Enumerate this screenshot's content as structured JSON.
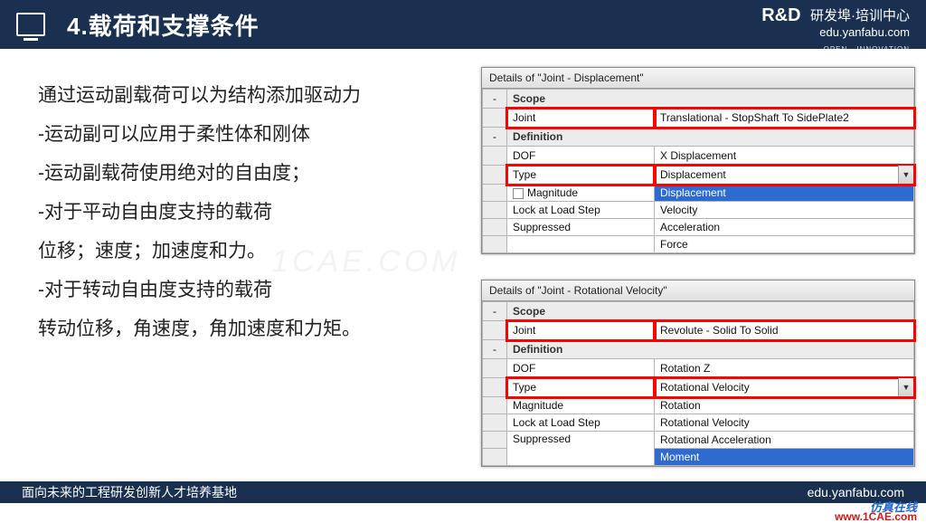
{
  "header": {
    "title": "4.载荷和支撑条件",
    "brand_logo": "R&D",
    "brand_tiny": "OPEN · INNOVATION",
    "brand_cn": "研发埠·培训中心",
    "brand_url": "edu.yanfabu.com"
  },
  "body_text": {
    "p1": "通过运动副载荷可以为结构添加驱动力",
    "p2": "-运动副可以应用于柔性体和刚体",
    "p3": "-运动副载荷使用绝对的自由度；",
    "p4": "-对于平动自由度支持的载荷",
    "p5": "位移；速度；加速度和力。",
    "p6": "-对于转动自由度支持的载荷",
    "p7": "转动位移，角速度，角加速度和力矩。"
  },
  "panel1": {
    "title": "Details of \"Joint - Displacement\"",
    "scope_label": "Scope",
    "joint_label": "Joint",
    "joint_value": "Translational - StopShaft To SidePlate2",
    "def_label": "Definition",
    "dof_label": "DOF",
    "dof_value": "X Displacement",
    "type_label": "Type",
    "type_value": "Displacement",
    "mag_label": "Magnitude",
    "lock_label": "Lock at Load Step",
    "sup_label": "Suppressed",
    "opts": [
      "Displacement",
      "Velocity",
      "Acceleration",
      "Force"
    ]
  },
  "panel2": {
    "title": "Details of \"Joint - Rotational Velocity\"",
    "scope_label": "Scope",
    "joint_label": "Joint",
    "joint_value": "Revolute - Solid To Solid",
    "def_label": "Definition",
    "dof_label": "DOF",
    "dof_value": "Rotation Z",
    "type_label": "Type",
    "type_value": "Rotational Velocity",
    "mag_label": "Magnitude",
    "lock_label": "Lock at Load Step",
    "sup_label": "Suppressed",
    "opts": [
      "Rotation",
      "Rotational Velocity",
      "Rotational Acceleration",
      "Moment"
    ]
  },
  "footer": {
    "left": "面向未来的工程研发创新人才培养基地",
    "right": "edu.yanfabu.com"
  },
  "watermark": {
    "center": "1CAE.COM",
    "blue": "仿真在线",
    "red": "www.1CAE.com"
  }
}
